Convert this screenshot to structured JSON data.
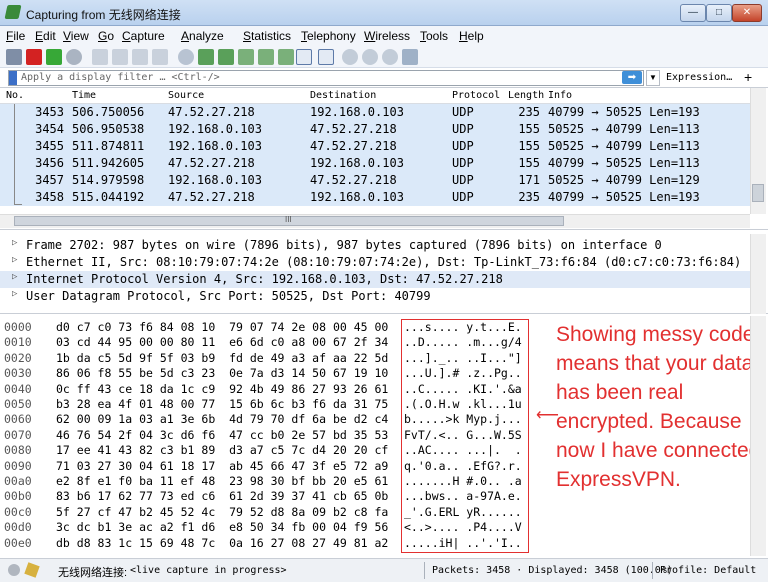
{
  "window": {
    "title": "Capturing from 无线网络连接",
    "min_glyph": "—",
    "max_glyph": "□",
    "close_glyph": "✕"
  },
  "menu": [
    "File",
    "Edit",
    "View",
    "Go",
    "Capture",
    "Analyze",
    "Statistics",
    "Telephony",
    "Wireless",
    "Tools",
    "Help"
  ],
  "filter": {
    "placeholder": "Apply a display filter … <Ctrl-/>",
    "apply_glyph": "➡",
    "dropdown_glyph": "▼",
    "expression_label": "Expression…",
    "add_glyph": "+"
  },
  "packet_list": {
    "columns": [
      "No.",
      "Time",
      "Source",
      "Destination",
      "Protocol",
      "Length",
      "Info"
    ],
    "rows": [
      {
        "no": "3453",
        "time": "506.750056",
        "src": "47.52.27.218",
        "dst": "192.168.0.103",
        "proto": "UDP",
        "len": "235",
        "info": "40799 → 50525 Len=193"
      },
      {
        "no": "3454",
        "time": "506.950538",
        "src": "192.168.0.103",
        "dst": "47.52.27.218",
        "proto": "UDP",
        "len": "155",
        "info": "50525 → 40799 Len=113"
      },
      {
        "no": "3455",
        "time": "511.874811",
        "src": "192.168.0.103",
        "dst": "47.52.27.218",
        "proto": "UDP",
        "len": "155",
        "info": "50525 → 40799 Len=113"
      },
      {
        "no": "3456",
        "time": "511.942605",
        "src": "47.52.27.218",
        "dst": "192.168.0.103",
        "proto": "UDP",
        "len": "155",
        "info": "40799 → 50525 Len=113"
      },
      {
        "no": "3457",
        "time": "514.979598",
        "src": "192.168.0.103",
        "dst": "47.52.27.218",
        "proto": "UDP",
        "len": "171",
        "info": "50525 → 40799 Len=129"
      },
      {
        "no": "3458",
        "time": "515.044192",
        "src": "47.52.27.218",
        "dst": "192.168.0.103",
        "proto": "UDP",
        "len": "235",
        "info": "40799 → 50525 Len=193"
      }
    ],
    "hscroll_glyph": "III"
  },
  "details": [
    "Frame 2702: 987 bytes on wire (7896 bits), 987 bytes captured (7896 bits) on interface 0",
    "Ethernet II, Src: 08:10:79:07:74:2e (08:10:79:07:74:2e), Dst: Tp-LinkT_73:f6:84 (d0:c7:c0:73:f6:84)",
    "Internet Protocol Version 4, Src: 192.168.0.103, Dst: 47.52.27.218",
    "User Datagram Protocol, Src Port: 50525, Dst Port: 40799"
  ],
  "details_arrow": "▷",
  "hex": [
    {
      "off": "0000",
      "hex": "d0 c7 c0 73 f6 84 08 10  79 07 74 2e 08 00 45 00",
      "ascii": "...s.... y.t...E."
    },
    {
      "off": "0010",
      "hex": "03 cd 44 95 00 00 80 11  e6 6d c0 a8 00 67 2f 34",
      "ascii": "..D..... .m...g/4"
    },
    {
      "off": "0020",
      "hex": "1b da c5 5d 9f 5f 03 b9  fd de 49 a3 af aa 22 5d",
      "ascii": "...]._.. ..I...\"]"
    },
    {
      "off": "0030",
      "hex": "86 06 f8 55 be 5d c3 23  0e 7a d3 14 50 67 19 10",
      "ascii": "...U.].# .z..Pg.."
    },
    {
      "off": "0040",
      "hex": "0c ff 43 ce 18 da 1c c9  92 4b 49 86 27 93 26 61",
      "ascii": "..C..... .KI.'.&a"
    },
    {
      "off": "0050",
      "hex": "b3 28 ea 4f 01 48 00 77  15 6b 6c b3 f6 da 31 75",
      "ascii": ".(.O.H.w .kl...1u"
    },
    {
      "off": "0060",
      "hex": "62 00 09 1a 03 a1 3e 6b  4d 79 70 df 6a be d2 c4",
      "ascii": "b.....>k Myp.j..."
    },
    {
      "off": "0070",
      "hex": "46 76 54 2f 04 3c d6 f6  47 cc b0 2e 57 bd 35 53",
      "ascii": "FvT/.<.. G...W.5S"
    },
    {
      "off": "0080",
      "hex": "17 ee 41 43 82 c3 b1 89  d3 a7 c5 7c d4 20 20 cf",
      "ascii": "..AC.... ...|.  ."
    },
    {
      "off": "0090",
      "hex": "71 03 27 30 04 61 18 17  ab 45 66 47 3f e5 72 a9",
      "ascii": "q.'0.a.. .EfG?.r."
    },
    {
      "off": "00a0",
      "hex": "e2 8f e1 f0 ba 11 ef 48  23 98 30 bf bb 20 e5 61",
      "ascii": ".......H #.0.. .a"
    },
    {
      "off": "00b0",
      "hex": "83 b6 17 62 77 73 ed c6  61 2d 39 37 41 cb 65 0b",
      "ascii": "...bws.. a-97A.e."
    },
    {
      "off": "00c0",
      "hex": "5f 27 cf 47 b2 45 52 4c  79 52 d8 8a 09 b2 c8 fa",
      "ascii": "_'.G.ERL yR......"
    },
    {
      "off": "00d0",
      "hex": "3c dc b1 3e ac a2 f1 d6  e8 50 34 fb 00 04 f9 56",
      "ascii": "<..>.... .P4....V"
    },
    {
      "off": "00e0",
      "hex": "db d8 83 1c 15 69 48 7c  0a 16 27 08 27 49 81 a2",
      "ascii": ".....iH| ..'.'I.."
    }
  ],
  "annotation": {
    "text": "Showing messy code means that your data has been real encrypted. Because now I have connected ExpressVPN.",
    "arrow_glyph": "⟵",
    "color": "#e23030"
  },
  "status": {
    "interface": "无线网络连接:",
    "capture": "<live capture in progress>",
    "packets": "Packets: 3458 · Displayed: 3458 (100.0%)",
    "profile": "Profile: Default"
  },
  "colors": {
    "row_highlight": "#dbe9f9",
    "title_gradient": "#b9d1ee",
    "apply_button": "#3f8fd8"
  }
}
